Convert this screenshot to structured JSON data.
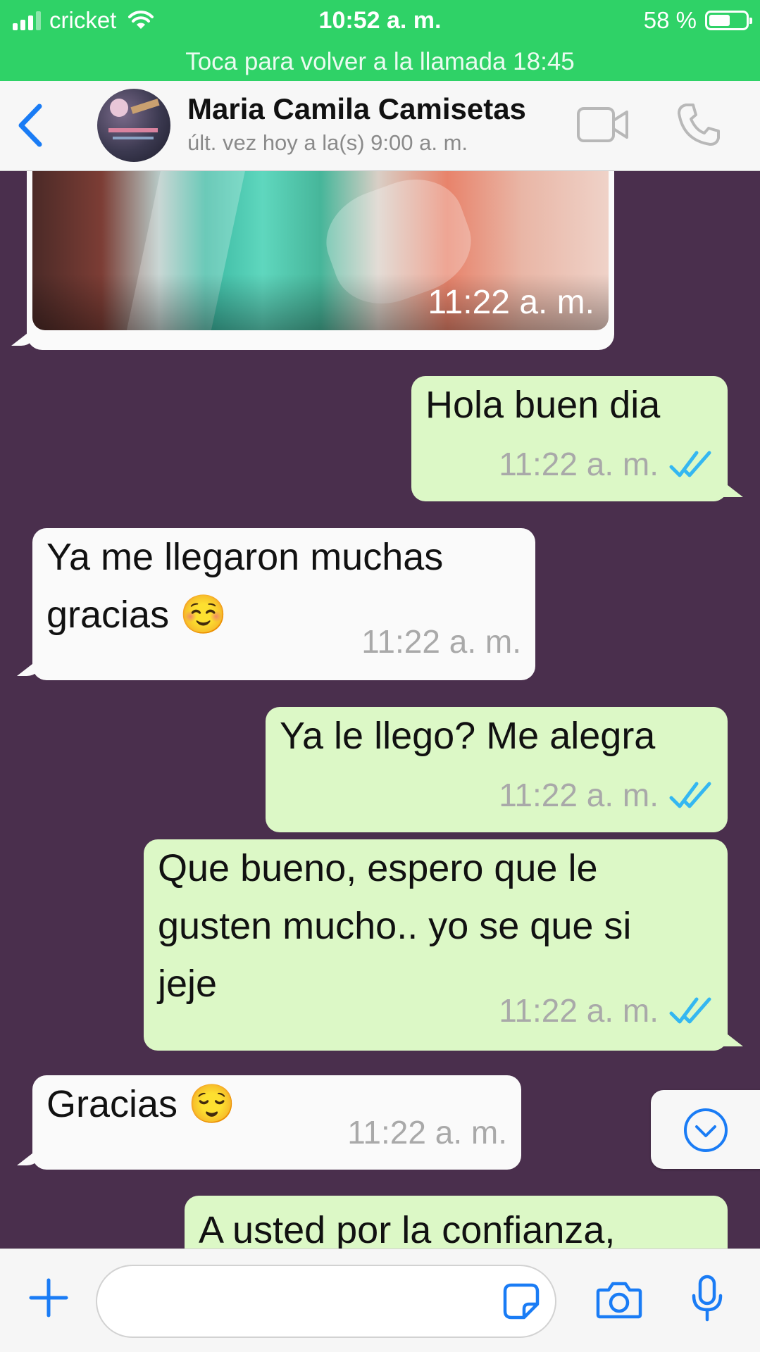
{
  "status_bar": {
    "carrier": "cricket",
    "time": "10:52 a. m.",
    "battery_text": "58 %",
    "battery_level": 0.58
  },
  "call_banner": {
    "text": "Toca para volver a la llamada 18:45"
  },
  "header": {
    "contact_name": "Maria Camila Camisetas",
    "last_seen": "últ. vez hoy a la(s) 9:00 a. m."
  },
  "messages": [
    {
      "direction": "in",
      "type": "image",
      "time": "11:22 a. m."
    },
    {
      "direction": "out",
      "text": "Hola buen dia",
      "time": "11:22 a. m.",
      "read": true
    },
    {
      "direction": "in",
      "text_lines": [
        "Ya me llegaron muchas",
        "gracias ☺️"
      ],
      "time": "11:22 a. m."
    },
    {
      "direction": "out",
      "text": "Ya le llego? Me alegra",
      "time": "11:22 a. m.",
      "read": true
    },
    {
      "direction": "out",
      "text_lines": [
        "Que bueno, espero que le",
        "gusten mucho.. yo se que si",
        "jeje"
      ],
      "time": "11:22 a. m.",
      "read": true
    },
    {
      "direction": "in",
      "text": "Gracias 😌",
      "time": "11:22 a. m."
    },
    {
      "direction": "out",
      "text": "A usted por la confianza,",
      "partial": true
    }
  ],
  "input": {
    "placeholder": ""
  },
  "colors": {
    "status_green": "#2fd267",
    "chat_background": "#4a2f4d",
    "incoming_bubble": "#fafafa",
    "outgoing_bubble": "#dcf8c6",
    "accent_blue": "#1a7cf5",
    "read_tick_blue": "#34b7f1"
  },
  "icons": [
    "signal-bars-icon",
    "wifi-icon",
    "battery-icon",
    "back-chevron-icon",
    "video-call-icon",
    "phone-call-icon",
    "double-check-icon",
    "scroll-down-icon",
    "plus-icon",
    "sticker-icon",
    "camera-icon",
    "microphone-icon"
  ]
}
